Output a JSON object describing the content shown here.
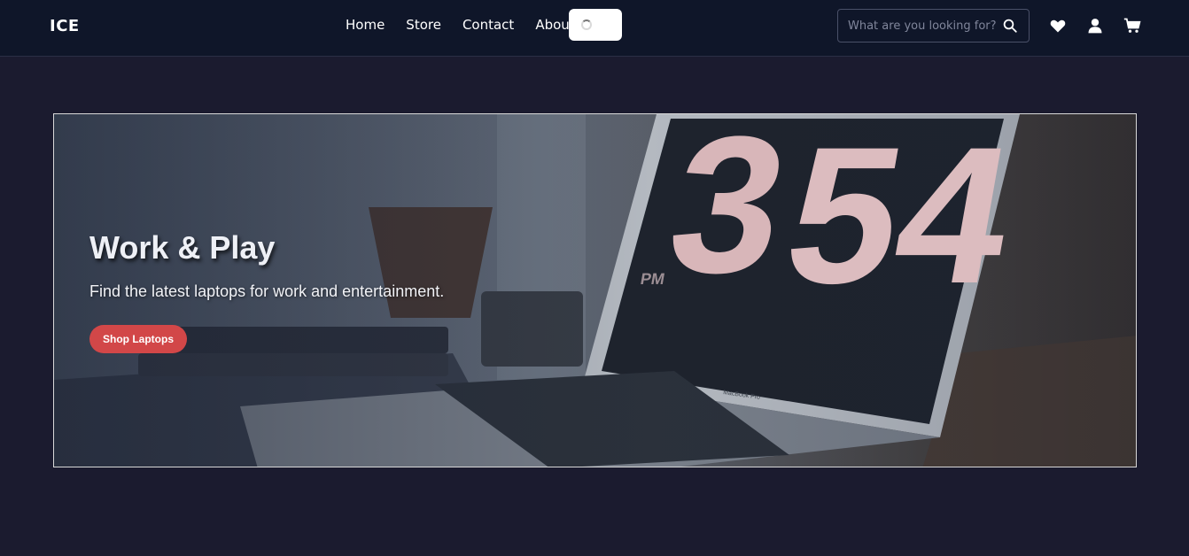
{
  "brand": "ICE",
  "nav": [
    {
      "label": "Home"
    },
    {
      "label": "Store"
    },
    {
      "label": "Contact"
    },
    {
      "label": "About"
    }
  ],
  "search": {
    "placeholder": "What are you looking for?"
  },
  "hero": {
    "title": "Work & Play",
    "subtitle": "Find the latest laptops for work and entertainment.",
    "button": "Shop Laptops",
    "clock_period": "PM",
    "clock_hour": "3",
    "clock_minutes": "54",
    "laptop_brand": "MacBook Pro"
  },
  "colors": {
    "navbar": "#0f1629",
    "page": "#1b1b2f",
    "cta": "#d24748"
  }
}
